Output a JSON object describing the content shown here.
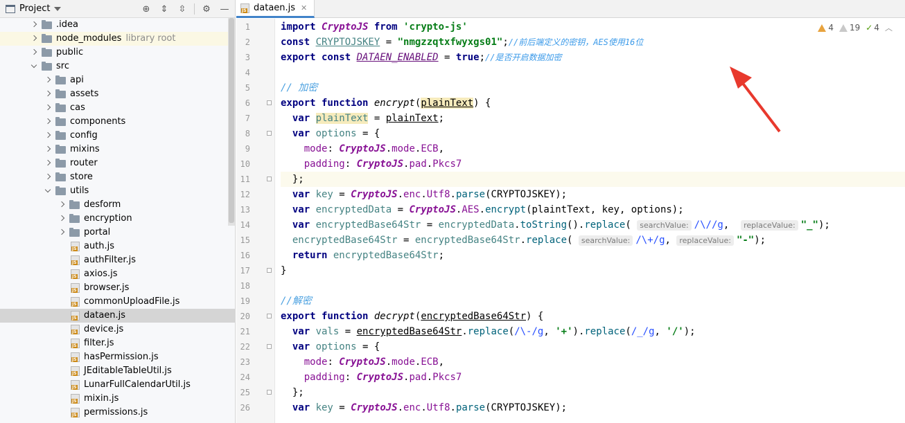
{
  "project_panel": {
    "title": "Project",
    "tree": [
      {
        "label": ".idea",
        "type": "folder",
        "depth": 1,
        "arrow": "collapsed"
      },
      {
        "label": "node_modules",
        "note": "library root",
        "type": "folder",
        "depth": 1,
        "arrow": "collapsed",
        "highlight": true
      },
      {
        "label": "public",
        "type": "folder",
        "depth": 1,
        "arrow": "collapsed"
      },
      {
        "label": "src",
        "type": "folder",
        "depth": 1,
        "arrow": "expanded"
      },
      {
        "label": "api",
        "type": "folder",
        "depth": 2,
        "arrow": "collapsed"
      },
      {
        "label": "assets",
        "type": "folder",
        "depth": 2,
        "arrow": "collapsed"
      },
      {
        "label": "cas",
        "type": "folder",
        "depth": 2,
        "arrow": "collapsed"
      },
      {
        "label": "components",
        "type": "folder",
        "depth": 2,
        "arrow": "collapsed"
      },
      {
        "label": "config",
        "type": "folder",
        "depth": 2,
        "arrow": "collapsed"
      },
      {
        "label": "mixins",
        "type": "folder",
        "depth": 2,
        "arrow": "collapsed"
      },
      {
        "label": "router",
        "type": "folder",
        "depth": 2,
        "arrow": "collapsed"
      },
      {
        "label": "store",
        "type": "folder",
        "depth": 2,
        "arrow": "collapsed"
      },
      {
        "label": "utils",
        "type": "folder",
        "depth": 2,
        "arrow": "expanded"
      },
      {
        "label": "desform",
        "type": "folder",
        "depth": 3,
        "arrow": "collapsed"
      },
      {
        "label": "encryption",
        "type": "folder",
        "depth": 3,
        "arrow": "collapsed"
      },
      {
        "label": "portal",
        "type": "folder",
        "depth": 3,
        "arrow": "collapsed"
      },
      {
        "label": "auth.js",
        "type": "js",
        "depth": 3
      },
      {
        "label": "authFilter.js",
        "type": "js",
        "depth": 3
      },
      {
        "label": "axios.js",
        "type": "js",
        "depth": 3
      },
      {
        "label": "browser.js",
        "type": "js",
        "depth": 3
      },
      {
        "label": "commonUploadFile.js",
        "type": "js",
        "depth": 3
      },
      {
        "label": "dataen.js",
        "type": "js",
        "depth": 3,
        "selected": true
      },
      {
        "label": "device.js",
        "type": "js",
        "depth": 3
      },
      {
        "label": "filter.js",
        "type": "js",
        "depth": 3
      },
      {
        "label": "hasPermission.js",
        "type": "js",
        "depth": 3
      },
      {
        "label": "JEditableTableUtil.js",
        "type": "js",
        "depth": 3
      },
      {
        "label": "LunarFullCalendarUtil.js",
        "type": "js",
        "depth": 3
      },
      {
        "label": "mixin.js",
        "type": "js",
        "depth": 3
      },
      {
        "label": "permissions.js",
        "type": "js",
        "depth": 3
      }
    ]
  },
  "editor": {
    "tab_label": "dataen.js",
    "tab_close": "✕",
    "caret_line": 11,
    "inspections": {
      "warnings": "4",
      "weak_warnings": "19",
      "ok": "4"
    },
    "line_numbers": [
      "1",
      "2",
      "3",
      "4",
      "5",
      "6",
      "7",
      "8",
      "9",
      "10",
      "11",
      "12",
      "13",
      "14",
      "15",
      "16",
      "17",
      "18",
      "19",
      "20",
      "21",
      "22",
      "23",
      "24",
      "25",
      "26"
    ],
    "lines": [
      [
        [
          "kw",
          "import "
        ],
        [
          "cls",
          "CryptoJS"
        ],
        [
          "kw",
          " from "
        ],
        [
          "str",
          "'crypto-js'"
        ]
      ],
      [
        [
          "kw",
          "const "
        ],
        [
          "const2",
          "CRYPTOJSKEY"
        ],
        [
          "t",
          " = "
        ],
        [
          "str",
          "\"nmgzzqtxfwyxgs01\""
        ],
        [
          "t",
          ";"
        ],
        [
          "cmtcn",
          "//前后端定义的密钥，AES使用16位"
        ]
      ],
      [
        [
          "kw",
          "export const "
        ],
        [
          "const",
          "DATAEN_ENABLED"
        ],
        [
          "t",
          " = "
        ],
        [
          "kw",
          "true"
        ],
        [
          "t",
          ";"
        ],
        [
          "cmtcn",
          "//是否开启数据加密"
        ]
      ],
      [],
      [
        [
          "cmtcn2",
          "// 加密"
        ]
      ],
      [
        [
          "kw",
          "export function "
        ],
        [
          "fn",
          "encrypt"
        ],
        [
          "t",
          "("
        ],
        [
          "hlul",
          "plainText"
        ],
        [
          "t",
          ") {"
        ]
      ],
      [
        [
          "t",
          "  "
        ],
        [
          "kw",
          "var "
        ],
        [
          "hlvar",
          "plainText"
        ],
        [
          "t",
          " = "
        ],
        [
          "ul",
          "plainText"
        ],
        [
          "t",
          ";"
        ]
      ],
      [
        [
          "t",
          "  "
        ],
        [
          "kw",
          "var "
        ],
        [
          "var",
          "options"
        ],
        [
          "t",
          " = {"
        ]
      ],
      [
        [
          "t",
          "    "
        ],
        [
          "prop",
          "mode"
        ],
        [
          "t",
          ": "
        ],
        [
          "cls",
          "CryptoJS"
        ],
        [
          "t",
          "."
        ],
        [
          "prop",
          "mode"
        ],
        [
          "t",
          "."
        ],
        [
          "prop",
          "ECB"
        ],
        [
          "t",
          ","
        ]
      ],
      [
        [
          "t",
          "    "
        ],
        [
          "prop",
          "padding"
        ],
        [
          "t",
          ": "
        ],
        [
          "cls",
          "CryptoJS"
        ],
        [
          "t",
          "."
        ],
        [
          "prop",
          "pad"
        ],
        [
          "t",
          "."
        ],
        [
          "prop",
          "Pkcs7"
        ]
      ],
      [
        [
          "t",
          "  };"
        ]
      ],
      [
        [
          "t",
          "  "
        ],
        [
          "kw",
          "var "
        ],
        [
          "var",
          "key"
        ],
        [
          "t",
          " = "
        ],
        [
          "cls",
          "CryptoJS"
        ],
        [
          "t",
          "."
        ],
        [
          "prop",
          "enc"
        ],
        [
          "t",
          "."
        ],
        [
          "prop",
          "Utf8"
        ],
        [
          "t",
          "."
        ],
        [
          "meth",
          "parse"
        ],
        [
          "t",
          "(CRYPTOJSKEY);"
        ]
      ],
      [
        [
          "t",
          "  "
        ],
        [
          "kw",
          "var "
        ],
        [
          "var",
          "encryptedData"
        ],
        [
          "t",
          " = "
        ],
        [
          "cls",
          "CryptoJS"
        ],
        [
          "t",
          "."
        ],
        [
          "prop",
          "AES"
        ],
        [
          "t",
          "."
        ],
        [
          "meth",
          "encrypt"
        ],
        [
          "t",
          "(plaintText, key, options);"
        ]
      ],
      [
        [
          "t",
          "  "
        ],
        [
          "kw",
          "var "
        ],
        [
          "var",
          "encryptedBase64Str"
        ],
        [
          "t",
          " = "
        ],
        [
          "var",
          "encryptedData"
        ],
        [
          "t",
          "."
        ],
        [
          "meth",
          "toString"
        ],
        [
          "t",
          "()."
        ],
        [
          "meth",
          "replace"
        ],
        [
          "t",
          "( "
        ],
        [
          "hint",
          "searchValue:"
        ],
        [
          "regex",
          "/\\//g"
        ],
        [
          "t",
          ",  "
        ],
        [
          "hint",
          "replaceValue:"
        ],
        [
          "str",
          "\"_\""
        ],
        [
          "t",
          ");"
        ]
      ],
      [
        [
          "t",
          "  "
        ],
        [
          "var",
          "encryptedBase64Str"
        ],
        [
          "t",
          " = "
        ],
        [
          "var",
          "encryptedBase64Str"
        ],
        [
          "t",
          "."
        ],
        [
          "meth",
          "replace"
        ],
        [
          "t",
          "( "
        ],
        [
          "hint",
          "searchValue:"
        ],
        [
          "regex",
          "/\\+/g"
        ],
        [
          "t",
          ", "
        ],
        [
          "hint",
          "replaceValue:"
        ],
        [
          "str",
          "\"-\""
        ],
        [
          "t",
          ");"
        ]
      ],
      [
        [
          "t",
          "  "
        ],
        [
          "kw",
          "return "
        ],
        [
          "var",
          "encryptedBase64Str"
        ],
        [
          "t",
          ";"
        ]
      ],
      [
        [
          "t",
          "}"
        ]
      ],
      [],
      [
        [
          "cmtcn2",
          "//解密"
        ]
      ],
      [
        [
          "kw",
          "export function "
        ],
        [
          "fn",
          "decrypt"
        ],
        [
          "t",
          "("
        ],
        [
          "ul",
          "encryptedBase64Str"
        ],
        [
          "t",
          ") {"
        ]
      ],
      [
        [
          "t",
          "  "
        ],
        [
          "kw",
          "var "
        ],
        [
          "var",
          "vals"
        ],
        [
          "t",
          " = "
        ],
        [
          "ul",
          "encryptedBase64Str"
        ],
        [
          "t",
          "."
        ],
        [
          "meth",
          "replace"
        ],
        [
          "t",
          "("
        ],
        [
          "regex",
          "/\\-/g"
        ],
        [
          "t",
          ", "
        ],
        [
          "str",
          "'+'"
        ],
        [
          "t",
          ")."
        ],
        [
          "meth",
          "replace"
        ],
        [
          "t",
          "("
        ],
        [
          "regex",
          "/_/g"
        ],
        [
          "t",
          ", "
        ],
        [
          "str",
          "'/'"
        ],
        [
          "t",
          ");"
        ]
      ],
      [
        [
          "t",
          "  "
        ],
        [
          "kw",
          "var "
        ],
        [
          "var",
          "options"
        ],
        [
          "t",
          " = {"
        ]
      ],
      [
        [
          "t",
          "    "
        ],
        [
          "prop",
          "mode"
        ],
        [
          "t",
          ": "
        ],
        [
          "cls",
          "CryptoJS"
        ],
        [
          "t",
          "."
        ],
        [
          "prop",
          "mode"
        ],
        [
          "t",
          "."
        ],
        [
          "prop",
          "ECB"
        ],
        [
          "t",
          ","
        ]
      ],
      [
        [
          "t",
          "    "
        ],
        [
          "prop",
          "padding"
        ],
        [
          "t",
          ": "
        ],
        [
          "cls",
          "CryptoJS"
        ],
        [
          "t",
          "."
        ],
        [
          "prop",
          "pad"
        ],
        [
          "t",
          "."
        ],
        [
          "prop",
          "Pkcs7"
        ]
      ],
      [
        [
          "t",
          "  };"
        ]
      ],
      [
        [
          "t",
          "  "
        ],
        [
          "kw",
          "var "
        ],
        [
          "var",
          "key"
        ],
        [
          "t",
          " = "
        ],
        [
          "cls",
          "CryptoJS"
        ],
        [
          "t",
          "."
        ],
        [
          "prop",
          "enc"
        ],
        [
          "t",
          "."
        ],
        [
          "prop",
          "Utf8"
        ],
        [
          "t",
          "."
        ],
        [
          "meth",
          "parse"
        ],
        [
          "t",
          "(CRYPTOJSKEY);"
        ]
      ]
    ]
  },
  "colors": {
    "annotation_arrow": "#e8392d",
    "tab_underline": "#4083c9",
    "selected_row": "#d5d5d5",
    "caret_line": "#fcfaed"
  }
}
